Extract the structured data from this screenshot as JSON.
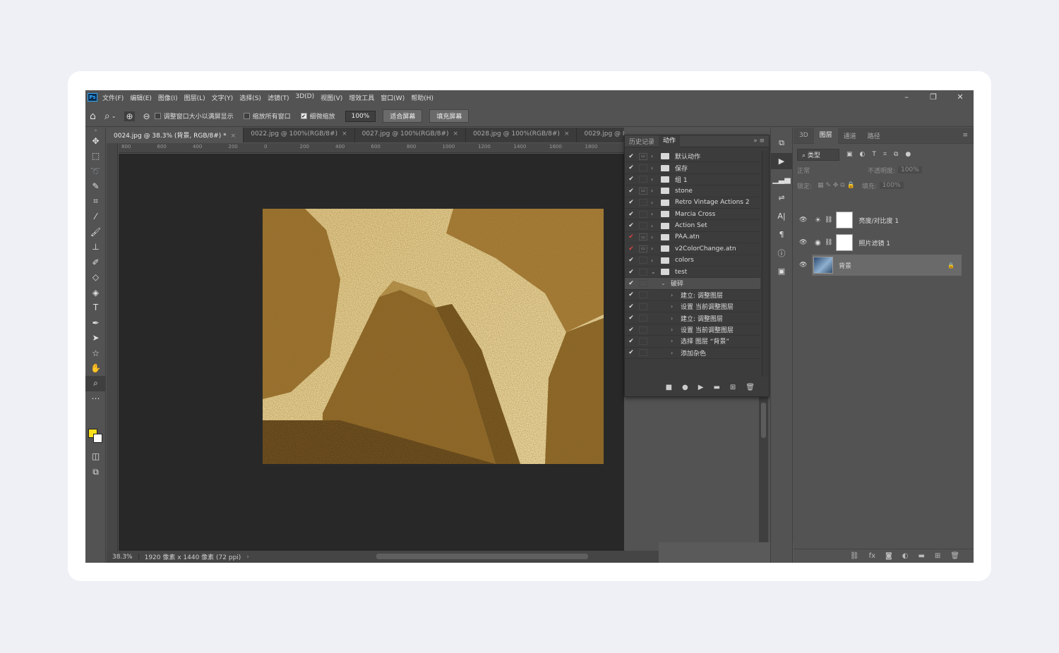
{
  "app": {
    "logo": "Ps",
    "menu": [
      "文件(F)",
      "编辑(E)",
      "图像(I)",
      "图层(L)",
      "文字(Y)",
      "选择(S)",
      "滤镜(T)",
      "3D(D)",
      "视图(V)",
      "增效工具",
      "窗口(W)",
      "帮助(H)"
    ],
    "window_controls": {
      "minimize": "–",
      "restore": "❐",
      "close": "✕"
    }
  },
  "options": {
    "resize_windows": "调整窗口大小以满屏显示",
    "zoom_all": "缩放所有窗口",
    "scrubby_zoom": "细微缩放",
    "zoom_value": "100%",
    "fit_screen": "适合屏幕",
    "fill_screen": "填充屏幕"
  },
  "tabs": [
    {
      "label": "0024.jpg @ 38.3% (背景, RGB/8#) *",
      "active": true
    },
    {
      "label": "0022.jpg @ 100%(RGB/8#)",
      "active": false
    },
    {
      "label": "0027.jpg @ 100%(RGB/8#)",
      "active": false
    },
    {
      "label": "0028.jpg @ 100%(RGB/8#)",
      "active": false
    },
    {
      "label": "0029.jpg @ 83.5%(RGB/8",
      "active": false
    }
  ],
  "ruler_ticks": [
    "800",
    "600",
    "400",
    "200",
    "0",
    "200",
    "400",
    "600",
    "800",
    "1000",
    "1200",
    "1400",
    "1600",
    "1800"
  ],
  "actions_panel": {
    "tab_history": "历史记录",
    "tab_actions": "动作",
    "items": [
      {
        "label": "默认动作",
        "level": 0,
        "dialog": true,
        "type": "set",
        "open": false,
        "check": "✔"
      },
      {
        "label": "保存",
        "level": 0,
        "dialog": false,
        "type": "set",
        "open": false,
        "check": "✔"
      },
      {
        "label": "组 1",
        "level": 0,
        "dialog": false,
        "type": "set",
        "open": false,
        "check": "✔"
      },
      {
        "label": "stone",
        "level": 0,
        "dialog": true,
        "type": "set",
        "open": false,
        "check": "✔"
      },
      {
        "label": "Retro Vintage Actions 2",
        "level": 0,
        "dialog": false,
        "type": "set",
        "open": false,
        "check": "✔"
      },
      {
        "label": "Marcia Cross",
        "level": 0,
        "dialog": false,
        "type": "set",
        "open": false,
        "check": "✔"
      },
      {
        "label": "Action Set",
        "level": 0,
        "dialog": false,
        "type": "set",
        "open": false,
        "check": "✔"
      },
      {
        "label": "PAA.atn",
        "level": 0,
        "dialog": true,
        "type": "set",
        "open": false,
        "check": "✔",
        "red": true
      },
      {
        "label": "v2ColorChange.atn",
        "level": 0,
        "dialog": true,
        "type": "set",
        "open": false,
        "check": "✔",
        "red": true
      },
      {
        "label": "colors",
        "level": 0,
        "dialog": false,
        "type": "set",
        "open": false,
        "check": "✔"
      },
      {
        "label": "test",
        "level": 0,
        "dialog": false,
        "type": "set",
        "open": true,
        "check": "✔"
      },
      {
        "label": "破碎",
        "level": 1,
        "dialog": false,
        "type": "action",
        "open": true,
        "check": "✔",
        "selected": true
      },
      {
        "label": "建立: 调整图层",
        "level": 2,
        "dialog": false,
        "type": "step",
        "check": "✔"
      },
      {
        "label": "设置 当前调整图层",
        "level": 2,
        "dialog": false,
        "type": "step",
        "check": "✔"
      },
      {
        "label": "建立: 调整图层",
        "level": 2,
        "dialog": false,
        "type": "step",
        "check": "✔"
      },
      {
        "label": "设置 当前调整图层",
        "level": 2,
        "dialog": false,
        "type": "step",
        "check": "✔"
      },
      {
        "label": "选择 图层 “背景”",
        "level": 2,
        "dialog": false,
        "type": "step",
        "check": "✔"
      },
      {
        "label": "添加杂色",
        "level": 2,
        "dialog": false,
        "type": "step",
        "check": "✔"
      }
    ]
  },
  "layers_panel": {
    "tabs": [
      "3D",
      "图层",
      "通道",
      "路径"
    ],
    "active_tab": "图层",
    "kind": "类型",
    "blend_mode": "正常",
    "opacity_label": "不透明度:",
    "opacity_value": "100%",
    "lock_label": "锁定:",
    "fill_label": "填充:",
    "fill_value": "100%",
    "layers": [
      {
        "name": "亮度/对比度 1",
        "type": "adjustment",
        "icon": "☀"
      },
      {
        "name": "照片滤镜 1",
        "type": "adjustment",
        "icon": "◉"
      },
      {
        "name": "背景",
        "type": "background",
        "icon": "🔒"
      }
    ]
  },
  "status": {
    "zoom": "38.3%",
    "doc_info": "1920 像素 x 1440 像素 (72 ppi)"
  },
  "colors": {
    "foreground": "#ffe11a",
    "background": "#ffffff",
    "image_tone": "#c8a04a"
  }
}
